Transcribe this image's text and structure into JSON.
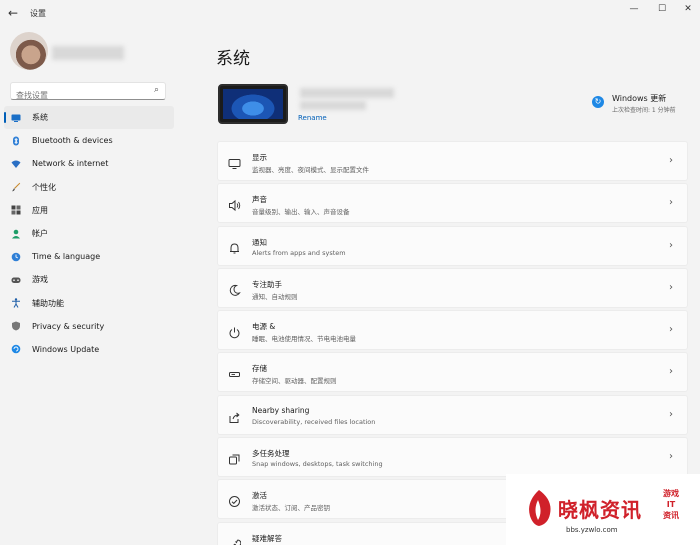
{
  "window": {
    "title": "设置",
    "back_glyph": "←",
    "minimize_glyph": "—",
    "maximize_glyph": "☐",
    "close_glyph": "✕"
  },
  "sidebar": {
    "search_placeholder": "查找设置",
    "items": [
      {
        "label": "系统",
        "icon": "monitor-icon",
        "active": true
      },
      {
        "label": "Bluetooth & devices",
        "icon": "bluetooth-icon"
      },
      {
        "label": "Network & internet",
        "icon": "wifi-icon"
      },
      {
        "label": "个性化",
        "icon": "brush-icon"
      },
      {
        "label": "应用",
        "icon": "apps-icon"
      },
      {
        "label": "帐户",
        "icon": "person-icon"
      },
      {
        "label": "Time & language",
        "icon": "globe-clock-icon"
      },
      {
        "label": "游戏",
        "icon": "gamepad-icon"
      },
      {
        "label": "辅助功能",
        "icon": "accessibility-icon"
      },
      {
        "label": "Privacy & security",
        "icon": "shield-icon"
      },
      {
        "label": "Windows Update",
        "icon": "update-icon"
      }
    ]
  },
  "main": {
    "title": "系统",
    "device": {
      "rename_label": "Rename"
    },
    "windows_update": {
      "title": "Windows 更新",
      "subtitle": "上次检查时间: 1 分钟前"
    },
    "cards": [
      {
        "title": "显示",
        "subtitle": "监视器、亮度、夜间模式、显示配置文件",
        "icon": "display-icon"
      },
      {
        "title": "声音",
        "subtitle": "音量级别、输出、输入、声音设备",
        "icon": "speaker-icon"
      },
      {
        "title": "通知",
        "subtitle": "Alerts from apps and system",
        "icon": "bell-icon"
      },
      {
        "title": "专注助手",
        "subtitle": "通知、自动规则",
        "icon": "moon-icon"
      },
      {
        "title": "电源 &",
        "subtitle": "睡眠、电池使用情况、节电电池电量",
        "icon": "power-icon"
      },
      {
        "title": "存储",
        "subtitle": "存储空间、驱动器、配置规则",
        "icon": "storage-icon"
      },
      {
        "title": "Nearby sharing",
        "subtitle": "Discoverability, received files location",
        "icon": "share-icon"
      },
      {
        "title": "多任务处理",
        "subtitle": "Snap windows, desktops, task switching",
        "icon": "multitask-icon"
      },
      {
        "title": "激活",
        "subtitle": "激活状态、订阅、产品密钥",
        "icon": "activation-icon"
      },
      {
        "title": "疑难解答",
        "subtitle": "",
        "icon": "wrench-icon"
      }
    ]
  },
  "watermark": {
    "main": "晓枫资讯",
    "url": "bbs.yzwlo.com",
    "side_lines": [
      "游戏",
      "IT",
      "资讯"
    ]
  },
  "colors": {
    "accent": "#005fb8",
    "background": "#f3f3f3",
    "watermark_red": "#d0212a"
  }
}
